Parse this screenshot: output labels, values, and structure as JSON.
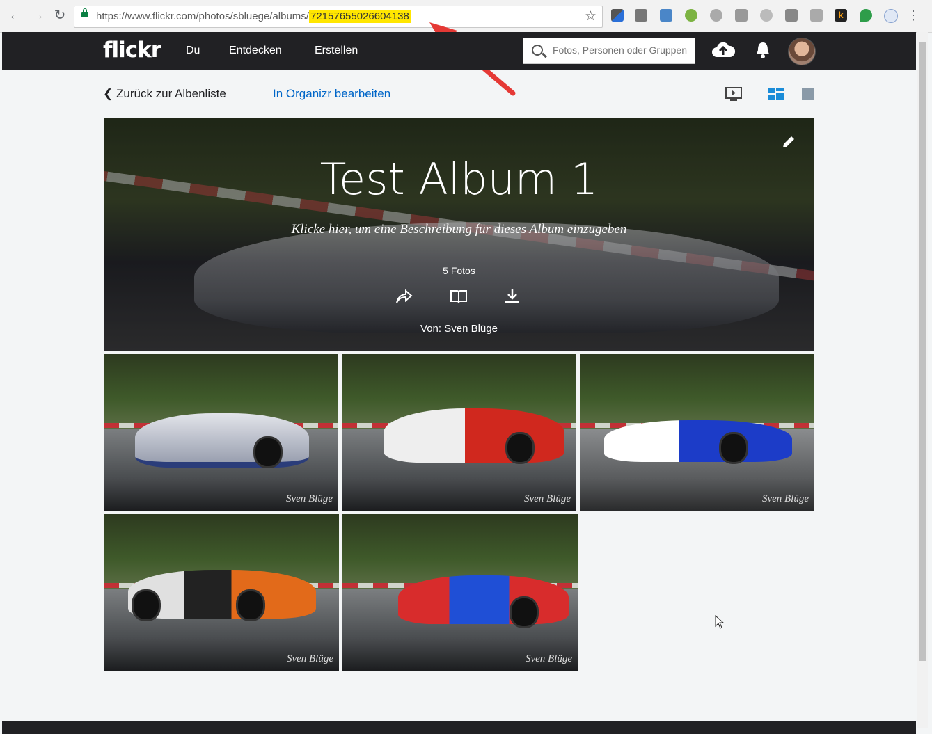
{
  "browser": {
    "url_prefix": "https://www.flickr.com/photos/sbluege/albums/",
    "url_album_id": "72157655026604138"
  },
  "header": {
    "logo": "flickr",
    "nav": [
      "Du",
      "Entdecken",
      "Erstellen"
    ],
    "search_placeholder": "Fotos, Personen oder Gruppen"
  },
  "subbar": {
    "back_label": "Zurück zur Albenliste",
    "organizr_label": "In Organizr bearbeiten"
  },
  "album": {
    "title": "Test Album 1",
    "description": "Klicke hier, um eine Beschreibung für dieses Album einzugeben",
    "count": "5 Fotos",
    "author": "Von: Sven Blüge"
  },
  "photos": [
    {
      "signature": "Sven Blüge",
      "car_color": "#c9ccd6",
      "accent": "#2b3d7a"
    },
    {
      "signature": "Sven Blüge",
      "car_color": "#e8e8e8",
      "accent": "#d0281e"
    },
    {
      "signature": "Sven Blüge",
      "car_color": "#ffffff",
      "accent": "#1c3cc8"
    },
    {
      "signature": "Sven Blüge",
      "car_color": "#e0e0e0",
      "accent": "#e26a1a"
    },
    {
      "signature": "Sven Blüge",
      "car_color": "#d82c2c",
      "accent": "#1f4fd6"
    }
  ],
  "colors": {
    "header_bg": "#212124",
    "link": "#0066c8",
    "highlight": "#ffe600",
    "arrow": "#e53935"
  }
}
